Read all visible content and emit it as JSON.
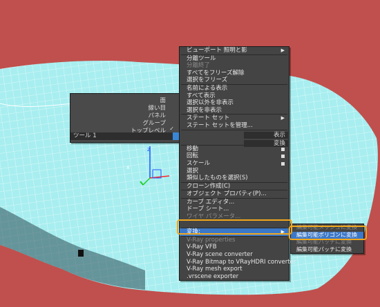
{
  "viewport": {
    "background_color": "#c0504d",
    "mesh_color": "#a8eef0",
    "wire_color": "#ffffff"
  },
  "left_menu": {
    "items": [
      {
        "label": "面",
        "checked": false
      },
      {
        "label": "縁い目",
        "checked": false
      },
      {
        "label": "パネル",
        "checked": false
      },
      {
        "label": "グループ",
        "checked": false
      },
      {
        "label": "トップレベル",
        "checked": true
      }
    ],
    "check_glyph": "✓",
    "tool_label": "ツール 1"
  },
  "main_menu": {
    "items": [
      {
        "label": "ビューポート 照明と影",
        "submenu": true,
        "sep_after": true
      },
      {
        "label": "分離ツール"
      },
      {
        "label": "分離終了",
        "disabled": true
      },
      {
        "label": "すべてをフリーズ解除"
      },
      {
        "label": "選択をフリーズ",
        "sep_after": true
      },
      {
        "label": "名前による表示"
      },
      {
        "label": "すべて表示"
      },
      {
        "label": "選択以外を非表示"
      },
      {
        "label": "選択を非表示",
        "sep_after": true
      },
      {
        "label": "ステート セット",
        "submenu": true
      },
      {
        "label": "ステート セットを管理...",
        "sep_after": true
      },
      {
        "label": ""
      },
      {
        "label": "",
        "sep_after": true
      },
      {
        "label": "移動",
        "box": true
      },
      {
        "label": "回転",
        "box": true
      },
      {
        "label": "スケール",
        "box": true
      },
      {
        "label": "選択"
      },
      {
        "label": "類似したものを選択(S)",
        "sep_after": true
      },
      {
        "label": "クローン作成(C)",
        "sep_after": true
      },
      {
        "label": "オブジェクト プロパティ(P)...",
        "sep_after": true
      },
      {
        "label": "カーブ エディタ..."
      },
      {
        "label": "ドープ シート..."
      },
      {
        "label": "ワイヤ パラメータ...",
        "disabled": true
      },
      {
        "label": "",
        "sep_after": true
      },
      {
        "label": "変換:",
        "submenu": true,
        "highlighted": true,
        "sep_after": true
      },
      {
        "label": "V-Ray properties",
        "disabled": true
      },
      {
        "label": "V-Ray VFB"
      },
      {
        "label": "V-Ray scene converter"
      },
      {
        "label": "V-Ray Bitmap to VRayHDRI converter"
      },
      {
        "label": "V-Ray mesh export"
      },
      {
        "label": ".vrscene exporter"
      }
    ]
  },
  "right_labels": {
    "display": "表示",
    "transform": "変換"
  },
  "sub_menu": {
    "items": [
      {
        "label": "編集可能メッシュに変換",
        "disabled": true
      },
      {
        "label": "編集可能ポリゴンに変換",
        "highlighted": true
      },
      {
        "label": "編集可能パッチに変換",
        "disabled": true
      },
      {
        "label": "編集可能パッチに変換"
      }
    ]
  },
  "highlight_color": "#f2a81d"
}
